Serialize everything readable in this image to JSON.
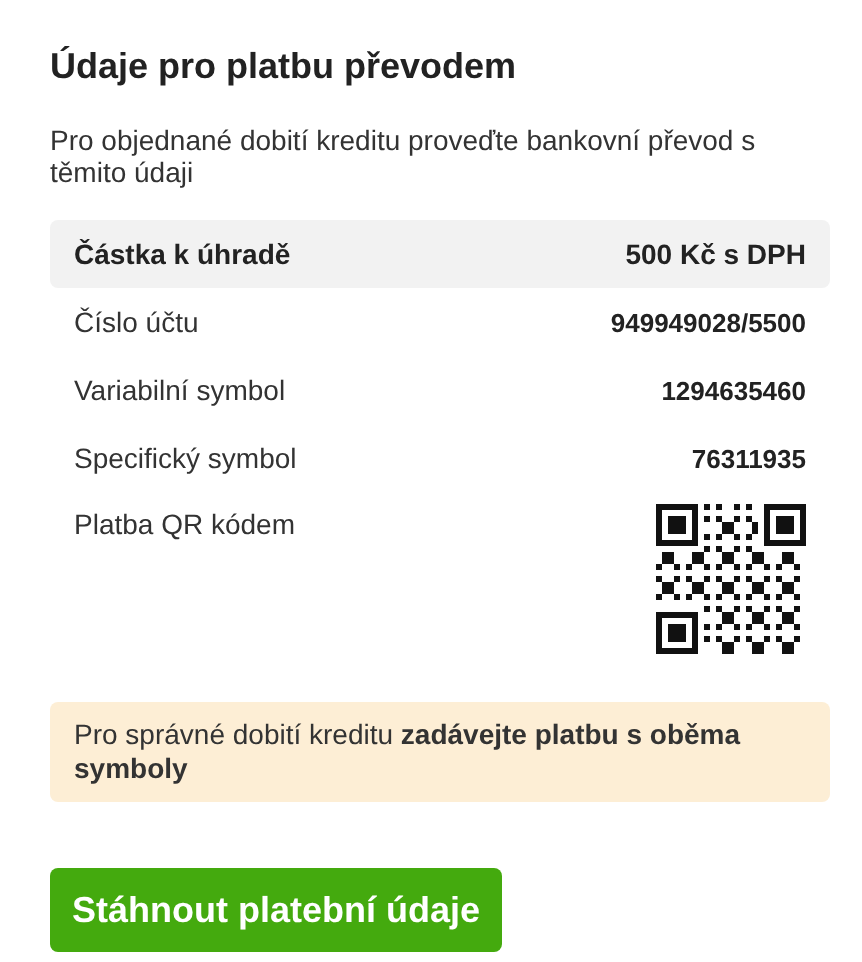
{
  "title": "Údaje pro platbu převodem",
  "intro": "Pro objednané dobití kreditu proveďte bankovní převod s těmito údaji",
  "rows": [
    {
      "kind": "total",
      "label": "Částka k úhradě",
      "value": "500 Kč s DPH"
    },
    {
      "kind": "text",
      "label": "Číslo účtu",
      "value": "949949028/5500"
    },
    {
      "kind": "text",
      "label": "Variabilní symbol",
      "value": "1294635460"
    },
    {
      "kind": "text",
      "label": "Specifický symbol",
      "value": "76311935"
    },
    {
      "kind": "qr",
      "label": "Platba QR kódem"
    }
  ],
  "notice": "Pro správné dobití kreditu **zadávejte platbu s oběma symboly**",
  "button": "Stáhnout platební údaje"
}
